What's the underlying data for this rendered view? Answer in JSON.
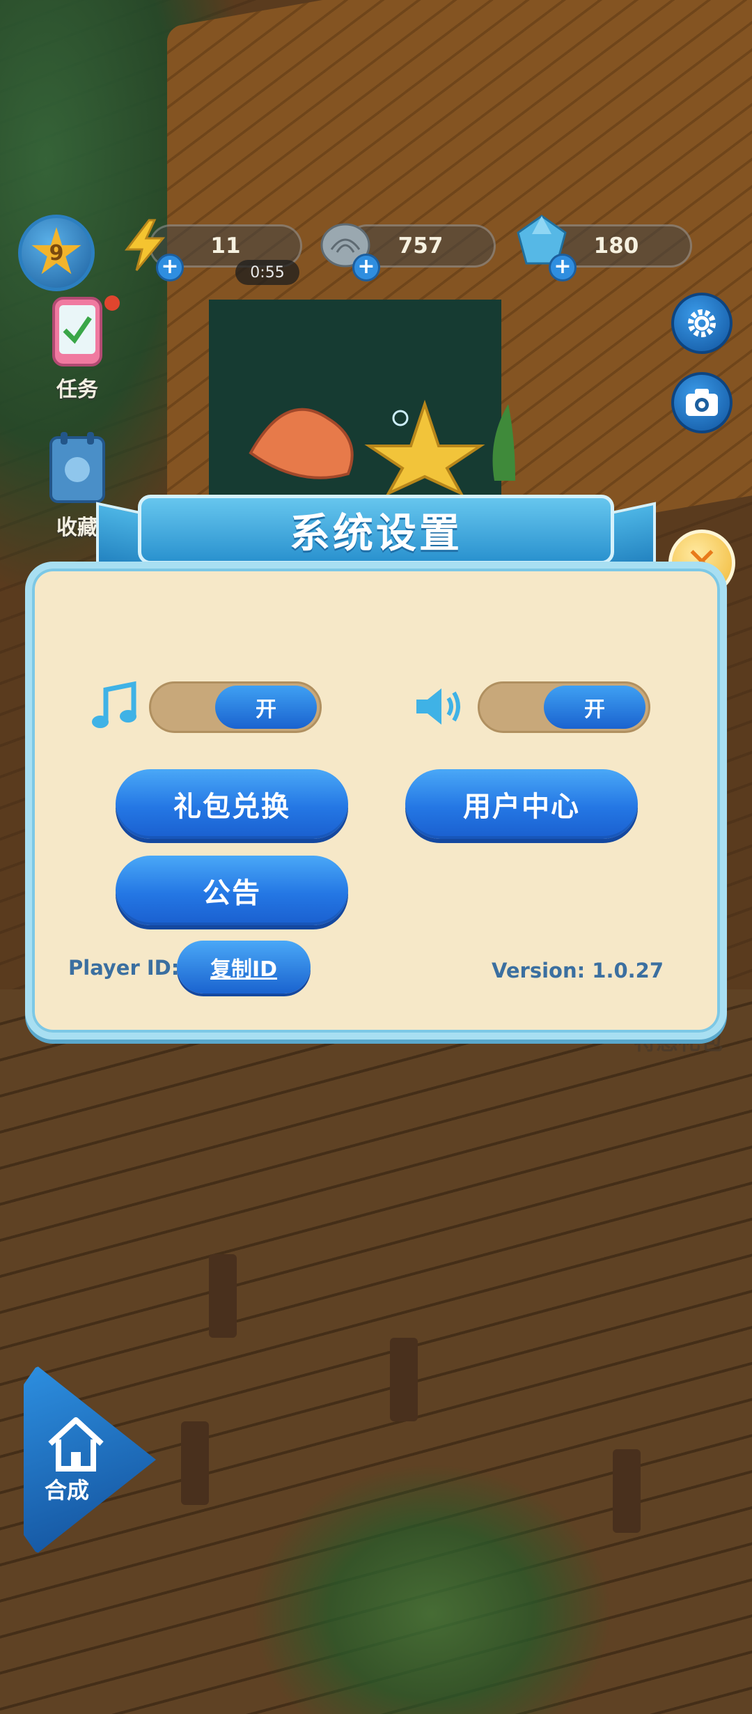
{
  "hud": {
    "level": "9",
    "energy": "11",
    "energy_timer": "0:55",
    "shells": "757",
    "gems": "180"
  },
  "sidebar": {
    "tasks_label": "任务",
    "collection_label": "收藏"
  },
  "bottom": {
    "merge_label": "合成",
    "gift_pack_label": "特惠礼包"
  },
  "settings": {
    "title": "系统设置",
    "music_toggle": "开",
    "sound_toggle": "开",
    "gift_redeem": "礼包兑换",
    "user_center": "用户中心",
    "announcement": "公告",
    "player_id_label": "Player ID:",
    "copy_id": "复制ID",
    "version": "Version: 1.0.27"
  },
  "colors": {
    "button_blue": "#2477e4",
    "panel_bg": "#f6e8c8",
    "panel_border": "#a8dff2",
    "close_gold": "#f0b733"
  }
}
